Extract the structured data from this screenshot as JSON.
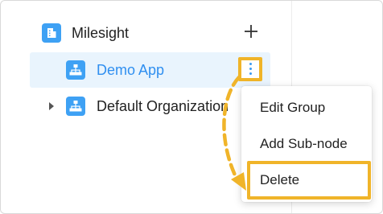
{
  "tree": {
    "root": {
      "label": "Milesight",
      "icon": "building-icon"
    },
    "items": [
      {
        "label": "Demo App",
        "icon": "hierarchy-icon",
        "selected": true
      },
      {
        "label": "Default Organization",
        "icon": "hierarchy-icon",
        "expandable": true
      }
    ],
    "add_icon": "plus-icon",
    "more_icon": "vertical-ellipsis-icon"
  },
  "context_menu": {
    "items": [
      {
        "label": "Edit Group"
      },
      {
        "label": "Add Sub-node"
      },
      {
        "label": "Delete",
        "highlighted": true
      }
    ]
  },
  "colors": {
    "accent": "#2f8ff0",
    "icon_bg": "#3ea1f4",
    "selected_bg": "#e9f4fd",
    "highlight": "#f0b429"
  }
}
